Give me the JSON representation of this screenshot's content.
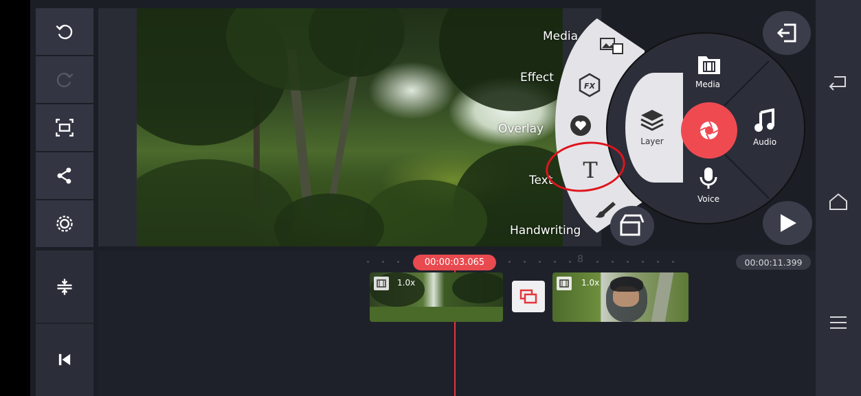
{
  "left_toolbar": {
    "buttons": [
      {
        "name": "undo-button",
        "icon": "undo-icon"
      },
      {
        "name": "redo-button",
        "icon": "redo-icon"
      },
      {
        "name": "aspect-button",
        "icon": "aspect-ratio-icon"
      },
      {
        "name": "share-button",
        "icon": "share-icon"
      },
      {
        "name": "settings-button",
        "icon": "gear-icon"
      }
    ],
    "timeline_buttons": [
      {
        "name": "timeline-expand-button",
        "icon": "expand-vertical-icon"
      },
      {
        "name": "skip-start-button",
        "icon": "skip-to-start-icon"
      }
    ]
  },
  "asset_menu": {
    "items": [
      {
        "label": "Media",
        "icon": "media-image-icon"
      },
      {
        "label": "Effect",
        "icon": "fx-icon"
      },
      {
        "label": "Overlay",
        "icon": "heart-sticker-icon"
      },
      {
        "label": "Text",
        "icon": "text-icon"
      },
      {
        "label": "Handwriting",
        "icon": "brush-icon"
      }
    ]
  },
  "wheel": {
    "media_label": "Media",
    "layer_label": "Layer",
    "audio_label": "Audio",
    "voice_label": "Voice",
    "center_icon": "camera-shutter-icon"
  },
  "timeline": {
    "current_time": "00:00:03.065",
    "total_time": "00:00:11.399",
    "marker": "8",
    "clips": [
      {
        "speed": "1.0x"
      },
      {
        "speed": "1.0x"
      }
    ]
  },
  "colors": {
    "accent": "#f04a51",
    "panel": "#333642",
    "background": "#1c1e26",
    "annotation": "#e0141c"
  }
}
